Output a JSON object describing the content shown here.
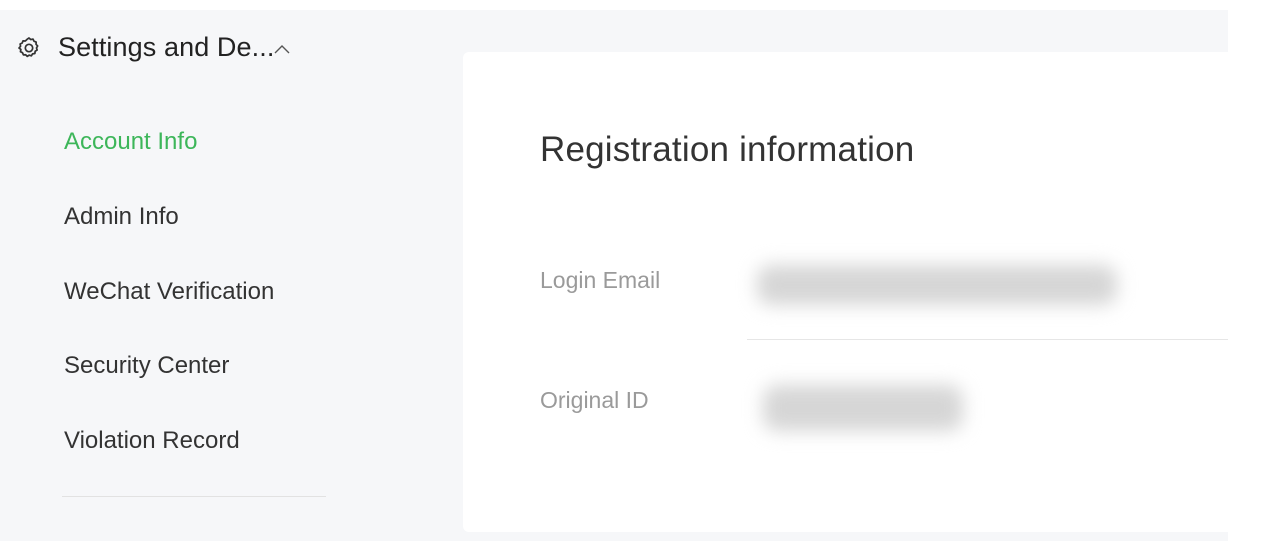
{
  "sidebar": {
    "header": {
      "title": "Settings and De...",
      "icon": "gear-icon",
      "chevron_icon": "chevron-up-icon"
    },
    "items": [
      {
        "label": "Account Info",
        "active": true
      },
      {
        "label": "Admin Info",
        "active": false
      },
      {
        "label": "WeChat Verification",
        "active": false
      },
      {
        "label": "Security Center",
        "active": false
      },
      {
        "label": "Violation Record",
        "active": false
      }
    ]
  },
  "main": {
    "heading": "Registration information",
    "fields": [
      {
        "label": "Login Email",
        "value_obscured": true
      },
      {
        "label": "Original ID",
        "value_obscured": true
      }
    ]
  },
  "colors": {
    "active": "#3db65a",
    "background": "#f6f7f9",
    "card": "#ffffff",
    "label": "#9a9a9a"
  }
}
